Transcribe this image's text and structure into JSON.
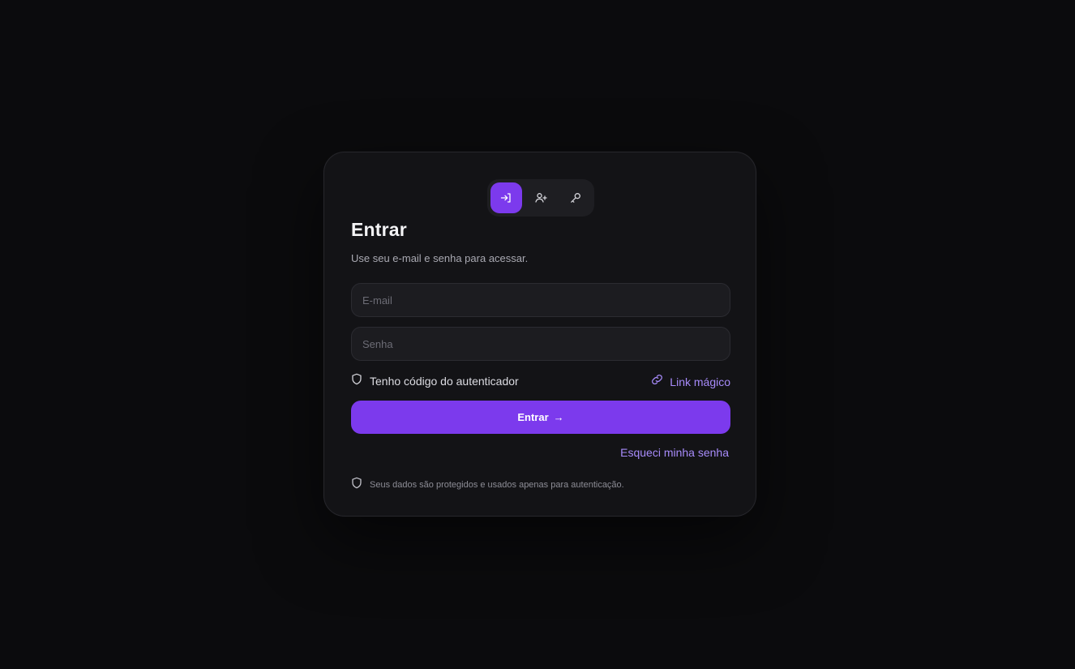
{
  "tabs": [
    {
      "icon": "login-icon",
      "label": "Entrar",
      "active": true
    },
    {
      "icon": "user-plus-icon",
      "label": "Cadastrar",
      "active": false
    },
    {
      "icon": "key-icon",
      "label": "Recuperar",
      "active": false
    }
  ],
  "header": {
    "title": "Entrar",
    "subtitle": "Use seu e-mail e senha para acessar."
  },
  "form": {
    "email_placeholder": "E-mail",
    "email_value": "",
    "password_placeholder": "Senha",
    "password_value": ""
  },
  "options": {
    "totp_label": "Tenho código do autenticador",
    "totp_icon": "shield-icon",
    "magic_link_label": "Link mágico",
    "magic_link_icon": "link-icon"
  },
  "submit": {
    "label": "Entrar",
    "arrow": "→"
  },
  "forgot_label": "Esqueci minha senha",
  "privacy": {
    "text": "Seus dados são protegidos e usados apenas para autenticação.",
    "icon": "shield-icon"
  },
  "colors": {
    "background": "#0b0b0d",
    "card": "#131316",
    "accent": "#7c3aed",
    "link": "#a78bfa"
  }
}
